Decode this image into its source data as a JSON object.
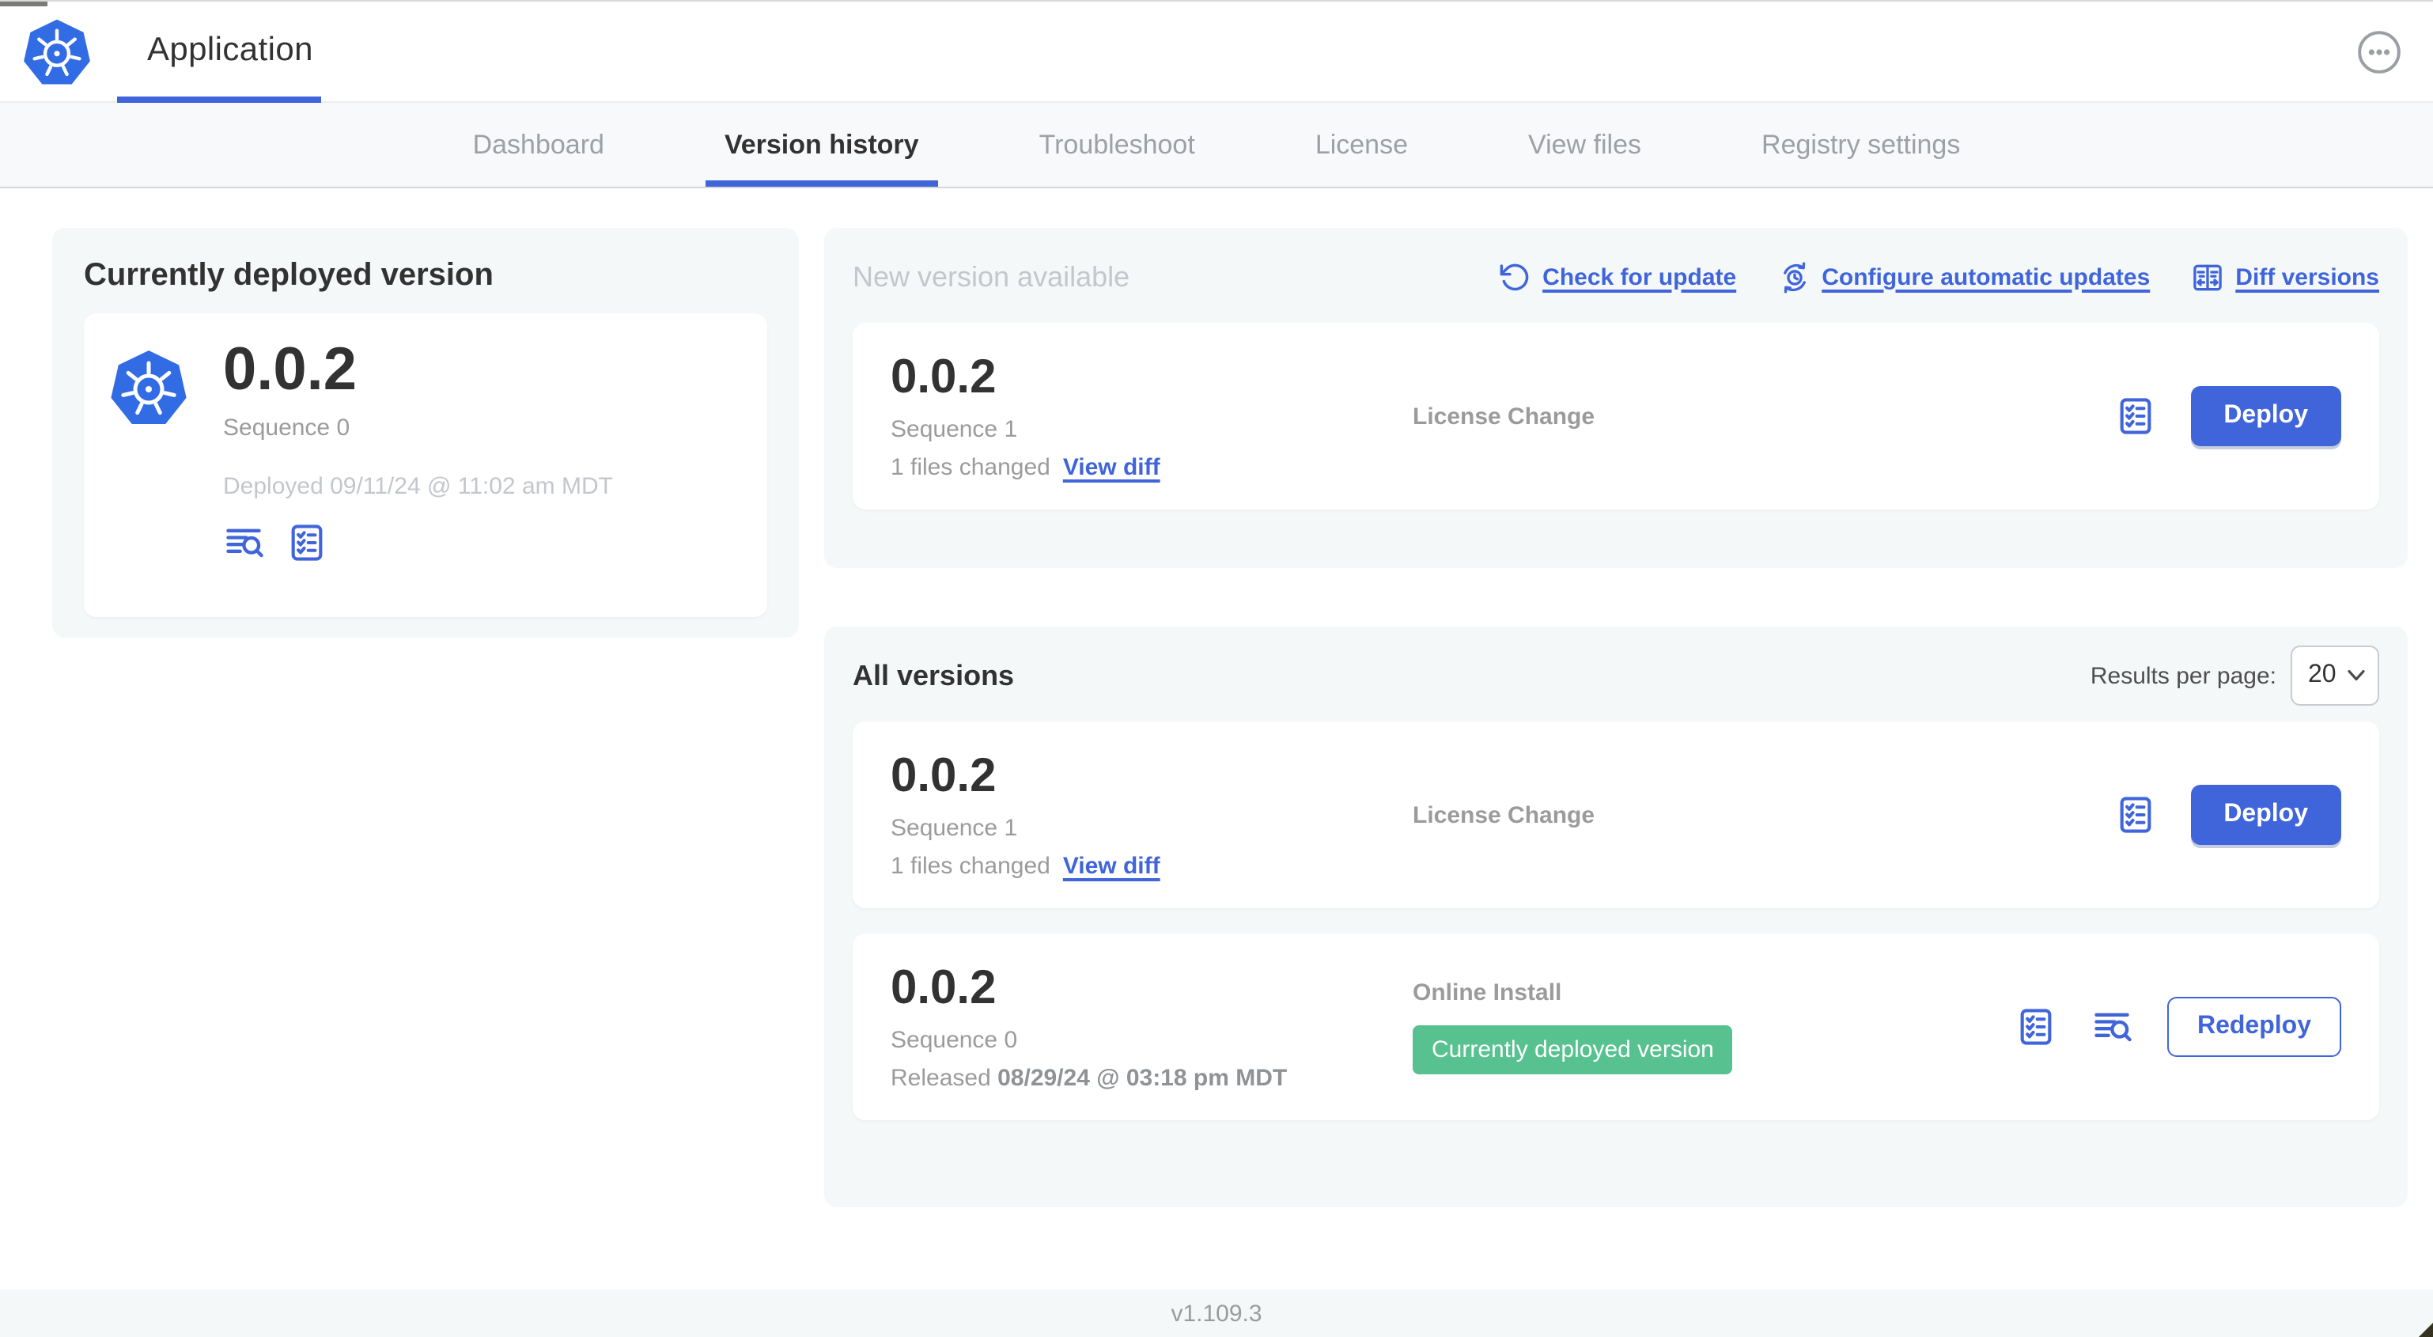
{
  "colors": {
    "accent_blue": "#4065DB",
    "kubernetes_logo_blue": "#326CE5",
    "badge_green": "#57C18F",
    "panel_gray": "#F5F8F9"
  },
  "header": {
    "app_title": "Application",
    "menu_icon": "ellipsis-circle-icon",
    "logo_icon": "kubernetes-helm-wheel-icon"
  },
  "nav": {
    "tabs": [
      {
        "label": "Dashboard",
        "active": false
      },
      {
        "label": "Version history",
        "active": true
      },
      {
        "label": "Troubleshoot",
        "active": false
      },
      {
        "label": "License",
        "active": false
      },
      {
        "label": "View files",
        "active": false
      },
      {
        "label": "Registry settings",
        "active": false
      }
    ]
  },
  "current_version_card": {
    "heading": "Currently deployed version",
    "version": "0.0.2",
    "sequence": "Sequence 0",
    "deployed": "Deployed 09/11/24 @ 11:02 am MDT",
    "icons": [
      "view-logs-icon",
      "version-checklist-icon"
    ]
  },
  "new_version_panel": {
    "heading": "New version available",
    "actions": {
      "check_for_update": "Check for update",
      "configure_automatic_updates": "Configure automatic updates",
      "diff_versions": "Diff versions"
    },
    "card": {
      "version": "0.0.2",
      "sequence": "Sequence 1",
      "files_changed": "1 files changed",
      "view_diff": "View diff",
      "source": "License Change",
      "deploy_button": "Deploy"
    }
  },
  "all_versions_panel": {
    "heading": "All versions",
    "results_per_page_label": "Results per page:",
    "results_per_page_value": "20",
    "rows": [
      {
        "version": "0.0.2",
        "sequence": "Sequence 1",
        "files_changed": "1 files changed",
        "view_diff": "View diff",
        "source": "License Change",
        "action_button": "Deploy"
      },
      {
        "version": "0.0.2",
        "sequence": "Sequence 0",
        "released_label": "Released",
        "released_date": "08/29/24 @ 03:18 pm MDT",
        "source": "Online Install",
        "badge": "Currently deployed version",
        "action_button": "Redeploy"
      }
    ]
  },
  "footer": {
    "version": "v1.109.3"
  }
}
